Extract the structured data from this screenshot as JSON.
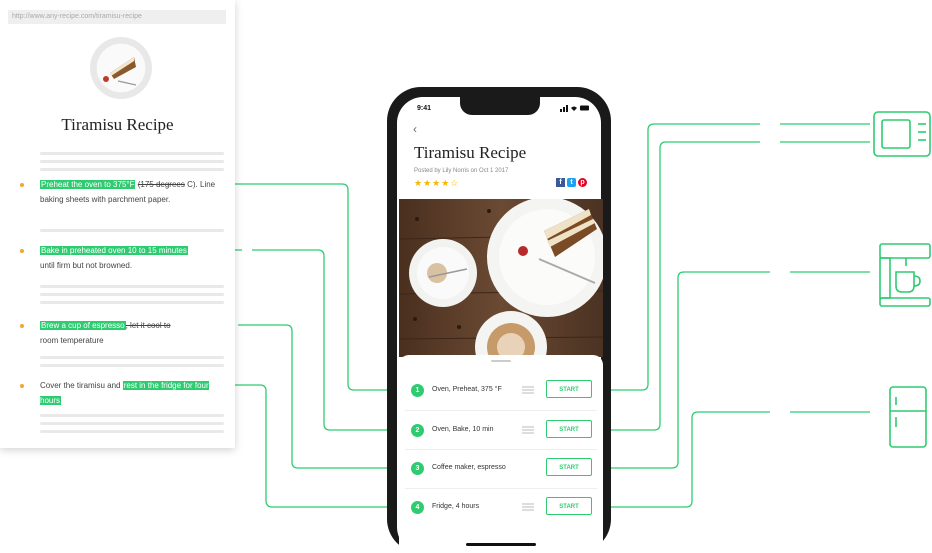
{
  "web_card": {
    "url": "http://www.any-recipe.com/tiramisu-recipe",
    "title": "Tiramisu Recipe",
    "steps": [
      {
        "highlight": "Preheat the oven to 375°F",
        "strike": "(175 degrees",
        "rest": "C). Line baking sheets with parchment paper."
      },
      {
        "highlight": "Bake in preheated oven 10 to 15 minutes",
        "rest": "until firm but not browned."
      },
      {
        "highlight": "Brew a cup of espresso",
        "strike": ", let it cool to",
        "rest": "room temperature"
      },
      {
        "pre": "Cover the tiramisu and",
        "highlight": "rest in the fridge for four hours"
      }
    ]
  },
  "phone": {
    "time": "9:41",
    "back": "‹",
    "title": "Tiramisu Recipe",
    "posted": "Posted by Lily Norris on Oct 1 2017",
    "stars": "★★★★☆",
    "social": [
      "f",
      "t",
      "p"
    ],
    "steps": [
      {
        "number": "1",
        "label": "Oven, Preheat, 375 °F",
        "button": "START"
      },
      {
        "number": "2",
        "label": "Oven, Bake, 10 min",
        "button": "START"
      },
      {
        "number": "3",
        "label": "Coffee maker, espresso",
        "button": "START"
      },
      {
        "number": "4",
        "label": "Fridge, 4 hours",
        "button": "START"
      }
    ]
  },
  "colors": {
    "accent": "#2ecc71",
    "star": "#f5b700",
    "bullet": "#f0a830",
    "facebook": "#3b5998",
    "twitter": "#1da1f2",
    "pinterest": "#e60023"
  },
  "appliances": [
    "oven-icon",
    "coffee-maker-icon",
    "fridge-icon"
  ]
}
